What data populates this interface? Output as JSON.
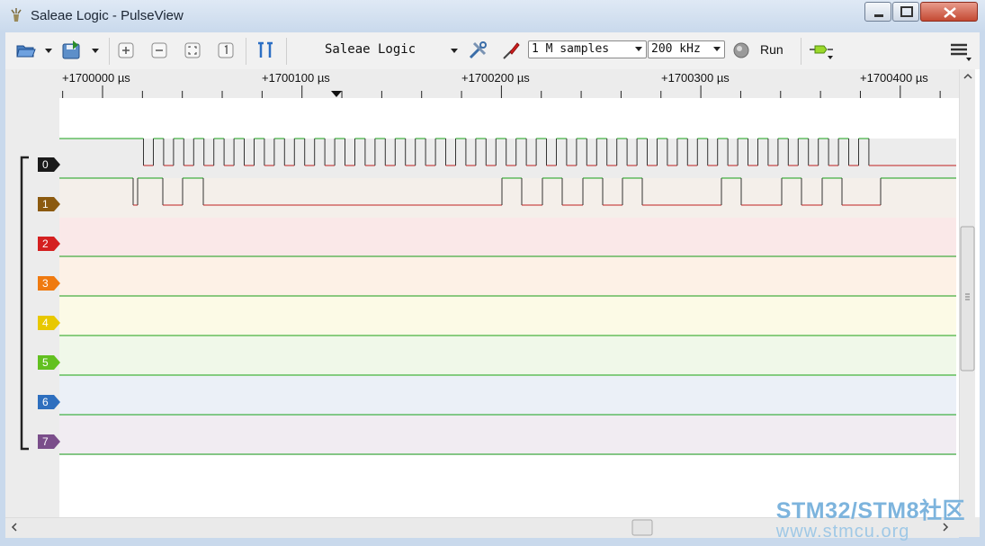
{
  "window": {
    "title": "Saleae Logic - PulseView"
  },
  "toolbar": {
    "device_name": "Saleae Logic",
    "sample_count": "1 M samples",
    "sample_rate": "200 kHz",
    "run_label": "Run"
  },
  "ruler": {
    "labels": [
      "+1700000 µs",
      "+1700100 µs",
      "+1700200 µs",
      "+1700300 µs",
      "+1700400 µs"
    ]
  },
  "channels": [
    {
      "label": "0",
      "color": "#1a1a1a",
      "bg": "#ececec"
    },
    {
      "label": "1",
      "color": "#8b5a10",
      "bg": "#f4efea"
    },
    {
      "label": "2",
      "color": "#d42020",
      "bg": "#fae8e8"
    },
    {
      "label": "3",
      "color": "#ef7a10",
      "bg": "#fdf1e6"
    },
    {
      "label": "4",
      "color": "#e8c800",
      "bg": "#fcfae6"
    },
    {
      "label": "5",
      "color": "#62c020",
      "bg": "#f0f8e9"
    },
    {
      "label": "6",
      "color": "#2e6fbe",
      "bg": "#ebf0f7"
    },
    {
      "label": "7",
      "color": "#7a4e8a",
      "bg": "#f1ecf2"
    }
  ],
  "colors": {
    "signal_high": "#18a018",
    "signal_low": "#c02020"
  },
  "watermark": {
    "line1": "STM32/STM8社区",
    "line2": "www.stmcu.org"
  }
}
